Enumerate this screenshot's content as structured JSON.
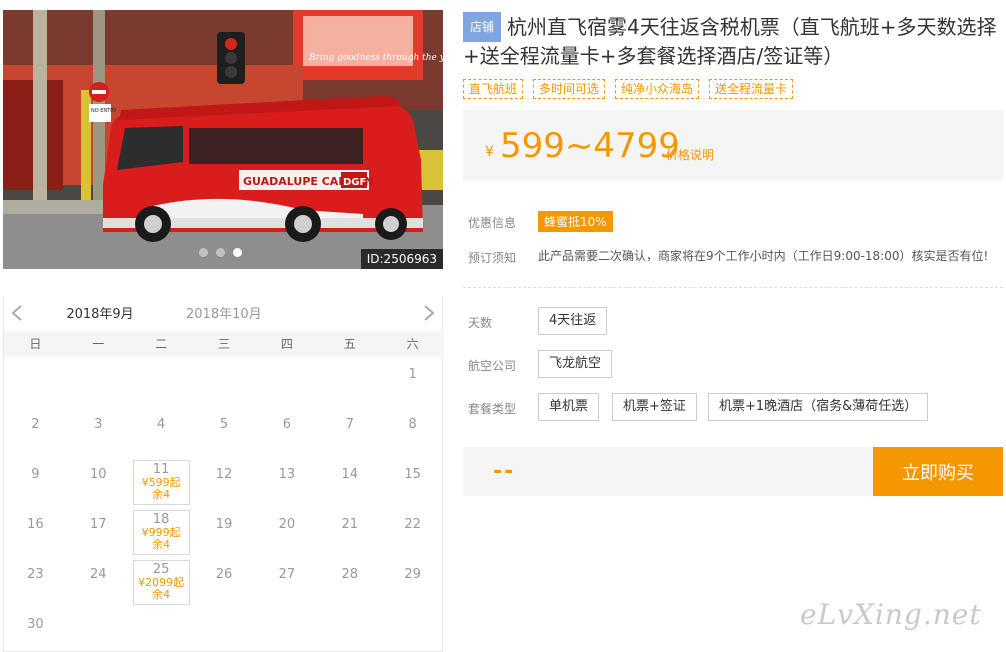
{
  "photo": {
    "id_label": "ID:2506963",
    "sign_text": "NO ENTRY",
    "van_text": "GUADALUPE CARBON",
    "van_text2": "DGF",
    "billboard_text": "Bring goodness through the years",
    "slides": 3,
    "active_slide": 2
  },
  "calendar": {
    "months": [
      "2018年9月",
      "2018年10月"
    ],
    "active_month": 0,
    "weekdays": [
      "日",
      "一",
      "二",
      "三",
      "四",
      "五",
      "六"
    ],
    "weeks": [
      [
        {
          "d": ""
        },
        {
          "d": ""
        },
        {
          "d": ""
        },
        {
          "d": ""
        },
        {
          "d": ""
        },
        {
          "d": ""
        },
        {
          "d": "1"
        }
      ],
      [
        {
          "d": "2"
        },
        {
          "d": "3"
        },
        {
          "d": "4"
        },
        {
          "d": "5"
        },
        {
          "d": "6"
        },
        {
          "d": "7"
        },
        {
          "d": "8"
        }
      ],
      [
        {
          "d": "9"
        },
        {
          "d": "10"
        },
        {
          "d": "11",
          "price": "¥599起",
          "remain": "余4"
        },
        {
          "d": "12"
        },
        {
          "d": "13"
        },
        {
          "d": "14"
        },
        {
          "d": "15"
        }
      ],
      [
        {
          "d": "16"
        },
        {
          "d": "17"
        },
        {
          "d": "18",
          "price": "¥999起",
          "remain": "余4"
        },
        {
          "d": "19"
        },
        {
          "d": "20"
        },
        {
          "d": "21"
        },
        {
          "d": "22"
        }
      ],
      [
        {
          "d": "23"
        },
        {
          "d": "24"
        },
        {
          "d": "25",
          "price": "¥2099起",
          "remain": "余4"
        },
        {
          "d": "26"
        },
        {
          "d": "27"
        },
        {
          "d": "28"
        },
        {
          "d": "29"
        }
      ],
      [
        {
          "d": "30"
        },
        {
          "d": ""
        },
        {
          "d": ""
        },
        {
          "d": ""
        },
        {
          "d": ""
        },
        {
          "d": ""
        },
        {
          "d": ""
        }
      ]
    ]
  },
  "product": {
    "shop_tag": "店铺",
    "title": "杭州直飞宿雾4天往返含税机票（直飞航班+多天数选择+送全程流量卡+多套餐选择酒店/签证等）",
    "tags": [
      "直飞航班",
      "多时间可选",
      "纯净小众海岛",
      "送全程流量卡"
    ]
  },
  "price": {
    "currency": "¥",
    "range": "599~4799",
    "note": "价格说明"
  },
  "info": {
    "promo_label": "优惠信息",
    "promo_badge": "蜂蜜抵10%",
    "notice_label": "预订须知",
    "notice_text": "此产品需要二次确认，商家将在9个工作小时内（工作日9:00-18:00）核实是否有位!"
  },
  "options": {
    "days_label": "天数",
    "days": [
      "4天往返"
    ],
    "airline_label": "航空公司",
    "airlines": [
      "飞龙航空"
    ],
    "package_label": "套餐类型",
    "packages": [
      "单机票",
      "机票+签证",
      "机票+1晚酒店（宿务&薄荷任选）"
    ]
  },
  "buy": {
    "price_placeholder": "--",
    "button": "立即购买"
  },
  "watermark": "eLvXing.net",
  "colors": {
    "accent": "#f39800",
    "shop_tag": "#7fa6e0"
  }
}
